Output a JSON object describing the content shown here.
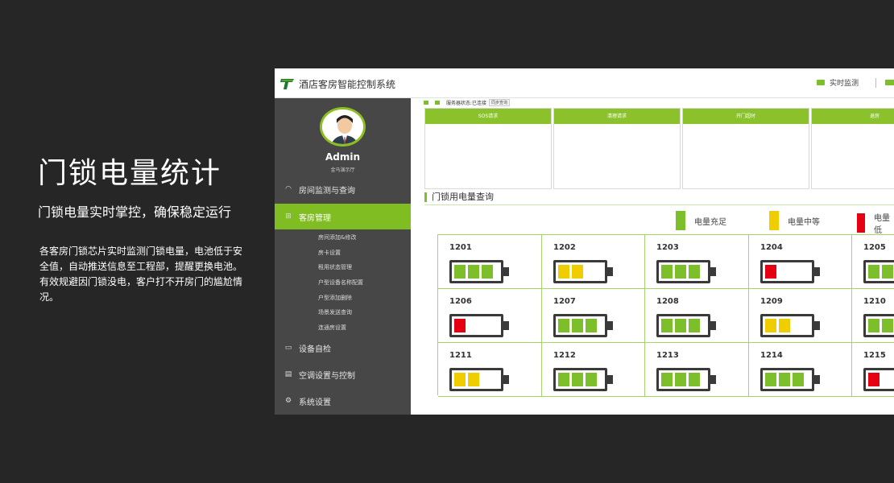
{
  "promo": {
    "title": "门锁电量统计",
    "subtitle": "门锁电量实时掌控，确保稳定运行",
    "description": "各客房门锁芯片实时监测门锁电量，电池低于安全值，自动推送信息至工程部，提醒更换电池。有效规避因门锁没电，客户打不开房门的尴尬情况。"
  },
  "app": {
    "title": "酒店客房智能控制系统",
    "top_monitor": "实时监测",
    "admin_name": "Admin",
    "admin_role": "金马演示厅",
    "nav": [
      {
        "label": "房间监测与查询",
        "icon": "gauge-icon"
      },
      {
        "label": "客房管理",
        "icon": "grid-icon"
      },
      {
        "label": "设备自检",
        "icon": "monitor-icon"
      },
      {
        "label": "空调设置与控制",
        "icon": "aircon-icon"
      },
      {
        "label": "系统设置",
        "icon": "settings-icon"
      }
    ],
    "subnav": [
      "房间添加&修改",
      "房卡设置",
      "租用状态管理",
      "户型设备名称配置",
      "户型添加删除",
      "场景发送查询",
      "连通房设置"
    ],
    "status_text": "服务器状态:已连接",
    "sync_label": "同步查询",
    "panels": [
      "SOS请求",
      "清理请求",
      "开门超时",
      "退房"
    ],
    "section_title": "门锁用电量查询",
    "legend": [
      {
        "label": "电量充足",
        "color": "#7dbf2a"
      },
      {
        "label": "电量中等",
        "color": "#f0cd00"
      },
      {
        "label": "电量低",
        "color": "#e50012"
      }
    ],
    "rooms": [
      {
        "room": "1201",
        "level": "full"
      },
      {
        "room": "1202",
        "level": "medium"
      },
      {
        "room": "1203",
        "level": "full"
      },
      {
        "room": "1204",
        "level": "low"
      },
      {
        "room": "1205",
        "level": "full"
      },
      {
        "room": "1206",
        "level": "low"
      },
      {
        "room": "1207",
        "level": "full"
      },
      {
        "room": "1208",
        "level": "full"
      },
      {
        "room": "1209",
        "level": "medium"
      },
      {
        "room": "1210",
        "level": "full"
      },
      {
        "room": "1211",
        "level": "medium"
      },
      {
        "room": "1212",
        "level": "full"
      },
      {
        "room": "1213",
        "level": "full"
      },
      {
        "room": "1214",
        "level": "full"
      },
      {
        "room": "1215",
        "level": "low"
      }
    ],
    "colors": {
      "full": "#7dbf2a",
      "medium": "#f0cd00",
      "low": "#e50012"
    }
  }
}
